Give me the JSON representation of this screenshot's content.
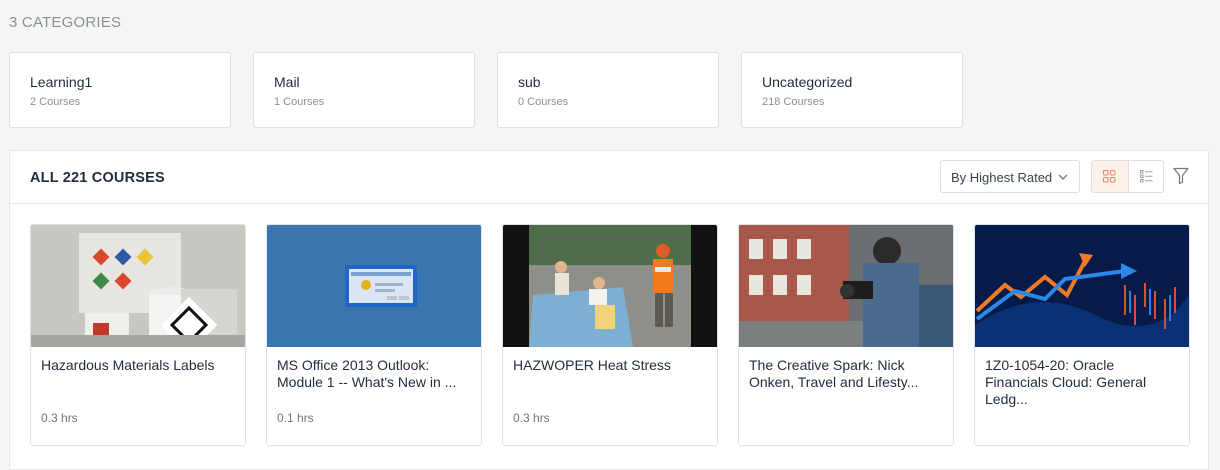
{
  "categories": {
    "heading": "3 CATEGORIES",
    "items": [
      {
        "name": "Learning1",
        "count": "2 Courses"
      },
      {
        "name": "Mail",
        "count": "1 Courses"
      },
      {
        "name": "sub",
        "count": "0 Courses"
      },
      {
        "name": "Uncategorized",
        "count": "218 Courses"
      }
    ]
  },
  "courses": {
    "heading": "ALL 221 COURSES",
    "sort": {
      "selected": "By Highest Rated"
    },
    "view": {
      "active": "grid",
      "grid_icon": "grid-icon",
      "list_icon": "list-icon",
      "filter_icon": "filter-icon"
    },
    "accent": "#f08a5d",
    "items": [
      {
        "title": "Hazardous Materials Labels",
        "duration": "0.3 hrs"
      },
      {
        "title": "MS Office 2013 Outlook: Module 1 -- What's New in ...",
        "duration": "0.1 hrs"
      },
      {
        "title": "HAZWOPER Heat Stress",
        "duration": "0.3 hrs"
      },
      {
        "title": "The Creative Spark: Nick Onken, Travel and Lifesty...",
        "duration": ""
      },
      {
        "title": "1Z0-1054-20: Oracle Financials Cloud: General Ledg...",
        "duration": ""
      }
    ]
  }
}
